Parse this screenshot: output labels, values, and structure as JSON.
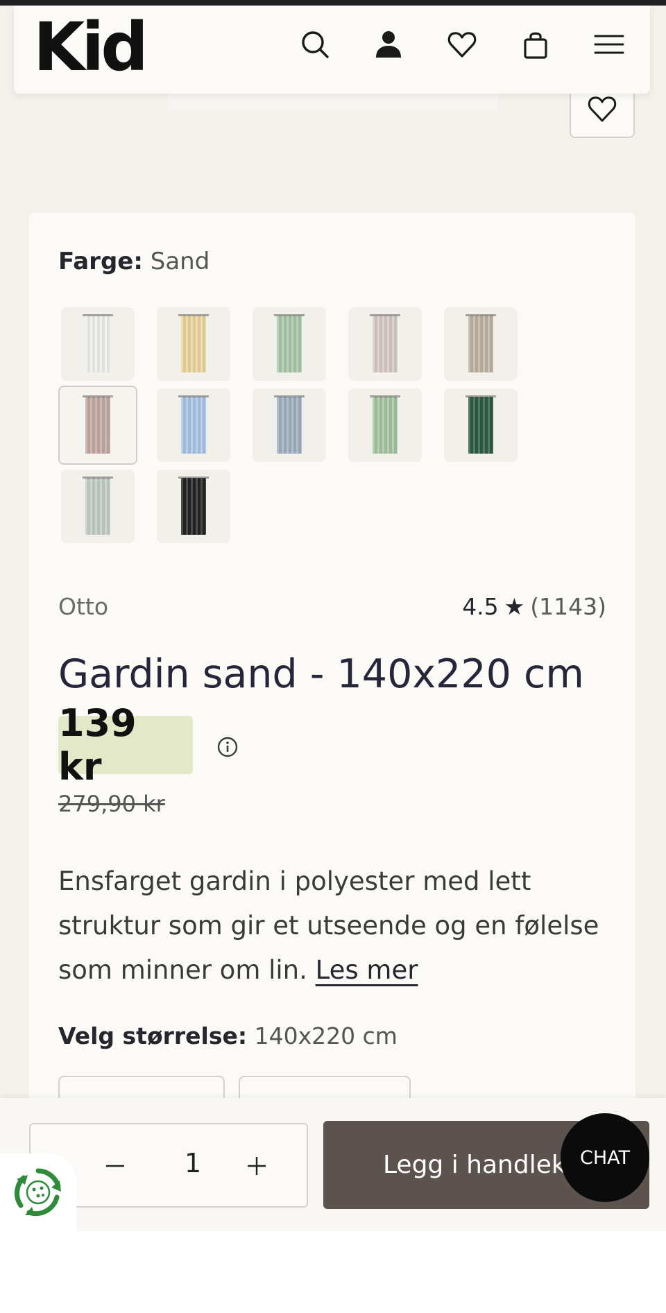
{
  "header": {
    "logo": "Kid",
    "icons": [
      "search-icon",
      "account-icon",
      "wishlist-icon",
      "cart-icon",
      "menu-icon"
    ]
  },
  "product": {
    "color_label": "Farge:",
    "color_value": "Sand",
    "swatches": [
      {
        "color": "#eeeeea"
      },
      {
        "color": "#ecd49e"
      },
      {
        "color": "#a9c8ab"
      },
      {
        "color": "#d6cbc5"
      },
      {
        "color": "#bdb3a2"
      },
      {
        "color": "#c3a9a4"
      },
      {
        "color": "#a9c3e6"
      },
      {
        "color": "#9fb0c1"
      },
      {
        "color": "#a5c39f"
      },
      {
        "color": "#2e5c44"
      },
      {
        "color": "#c2ccc6"
      },
      {
        "color": "#242424"
      }
    ],
    "selected_swatch_index": 5,
    "brand": "Otto",
    "rating": "4.5",
    "rating_star": "★",
    "rating_count": "(1143)",
    "title": "Gardin sand - 140x220 cm",
    "price": "139 kr",
    "old_price": "279,90 kr",
    "description": "Ensfarget gardin i polyester med lett struktur som gir et utseende og en følelse som minner om lin.",
    "read_more": "Les mer",
    "size_label": "Velg størrelse:",
    "size_value": "140x220 cm"
  },
  "cart": {
    "quantity": "1",
    "add_label": "Legg i handlekurv"
  },
  "chat": {
    "label": "CHAT"
  },
  "colors": {
    "page_bg": "#f3f1ea",
    "card_bg": "#fbfaf6",
    "price_highlight": "#e3e8c8",
    "button_bg": "#5c534f",
    "chat_bg": "#0b0b0b",
    "eco_green": "#2e8b3a"
  }
}
